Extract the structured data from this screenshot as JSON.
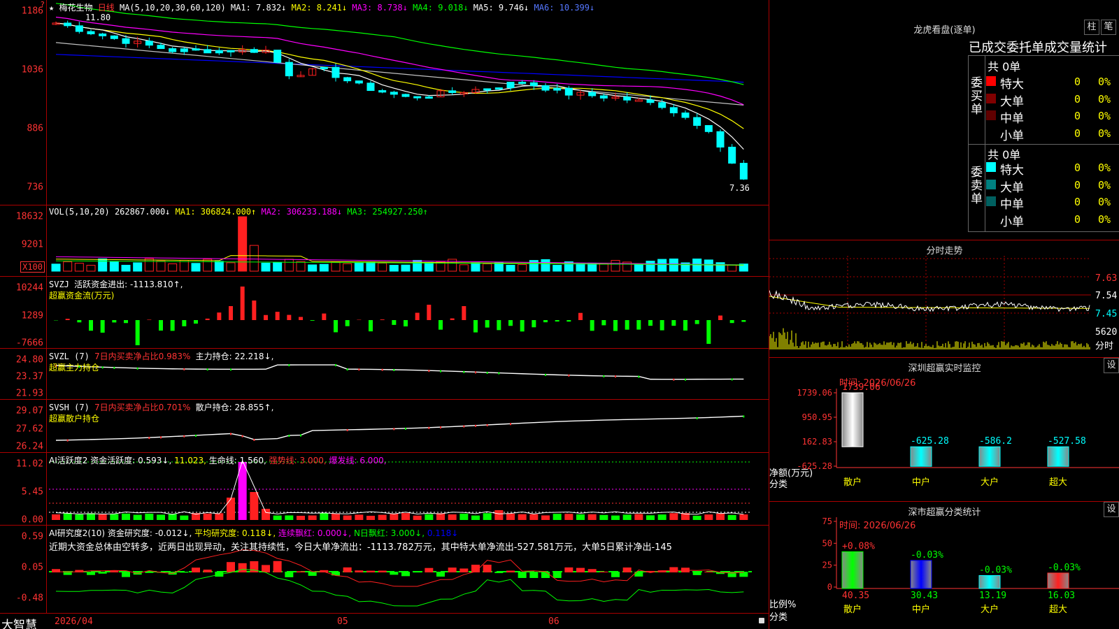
{
  "stock": {
    "name": "梅花生物",
    "period": "日线",
    "star": "★",
    "mark": "?"
  },
  "colors": {
    "up": "#ff2020",
    "down": "#00ffff",
    "ma1": "#ffffff",
    "ma2": "#ffff00",
    "ma3": "#ff00ff",
    "ma4": "#00ff00",
    "ma5": "#c0c0c0",
    "ma6": "#0000ff"
  },
  "price_panel": {
    "header": {
      "label": "MA(5,10,20,30,60,120)",
      "ma1": "MA1: 7.832↓",
      "ma2": "MA2: 8.241↓",
      "ma3": "MA3: 8.738↓",
      "ma4": "MA4: 9.018↓",
      "ma5": "MA5: 9.746↓",
      "ma6": "MA6: 10.399↓"
    },
    "ticks": [
      "1186",
      "1036",
      "886",
      "736"
    ],
    "high_label": "11.80",
    "low_label": "7.36"
  },
  "vol_panel": {
    "header": {
      "label": "VOL(5,10,20)",
      "v": "262867.000↓",
      "ma1": "MA1: 306824.000↑",
      "ma2": "MA2: 306233.188↓",
      "ma3": "MA3: 254927.250↑"
    },
    "ticks": [
      "18632",
      "9201"
    ],
    "unit": "X100"
  },
  "svzj_panel": {
    "header": {
      "label": "SVZJ",
      "text": "活跃资金进出: -1113.810↑,"
    },
    "subtitle": "超赢资金流(万元)",
    "ticks": [
      "10244",
      "1289",
      "-7666"
    ]
  },
  "svzl_panel": {
    "header": {
      "label": "SVZL (7)",
      "text1": "7日内买卖净占比0.983%",
      "text2": "主力持仓: 22.218↓,"
    },
    "subtitle": "超赢主力持仓",
    "ticks": [
      "24.80",
      "23.37",
      "21.93"
    ]
  },
  "svsh_panel": {
    "header": {
      "label": "SVSH (7)",
      "text1": "7日内买卖净占比0.701%",
      "text2": "散户持仓: 28.855↑,"
    },
    "subtitle": "超赢散户持仓",
    "ticks": [
      "29.07",
      "27.62",
      "26.24"
    ]
  },
  "ai_panel": {
    "header": {
      "label": "AI活跃度2",
      "t1": "资金活跃度: 0.593↓,",
      "t2": "11.023,",
      "t3": "生命线: 1.560,",
      "t4": "强势线: 3.000,",
      "t5": "爆发线: 6.000,"
    },
    "ticks": [
      "11.02",
      "5.45",
      "0.00"
    ]
  },
  "research_panel": {
    "header": {
      "label": "AI研究度2(10)",
      "t1": "资金研究度: -0.012↓,",
      "t2": "平均研究度: 0.118↓,",
      "t3": "连续飘红: 0.000↓,",
      "t4": "N日飘红: 3.000↓,",
      "t5": "0.118↓"
    },
    "comment": "近期大资金总体由空转多，近两日出现异动，关注其持续性，今日大单净流出：-1113.782万元，其中特大单净流出-527.581万元，大单5日累计净出-145",
    "ticks": [
      "0.59",
      "0.05",
      "-0.48"
    ]
  },
  "bottom_axis": {
    "brand": "大智慧",
    "date": "2026/04",
    "m1": "05",
    "m2": "06"
  },
  "dragon": {
    "title": "龙虎看盘(逐单)",
    "btn1": "柱",
    "btn2": "笔",
    "subtitle": "已成交委托单成交量统计",
    "buy": {
      "side": "委买单",
      "total": "共 0单",
      "rows": [
        {
          "name": "特大",
          "qty": "0",
          "pct": "0%",
          "color": "#ff0000"
        },
        {
          "name": "大单",
          "qty": "0",
          "pct": "0%",
          "color": "#800000"
        },
        {
          "name": "中单",
          "qty": "0",
          "pct": "0%",
          "color": "#600000"
        },
        {
          "name": "小单",
          "qty": "0",
          "pct": "0%",
          "color": "#000000"
        }
      ]
    },
    "sell": {
      "side": "委卖单",
      "total": "共 0单",
      "rows": [
        {
          "name": "特大",
          "qty": "0",
          "pct": "0%",
          "color": "#00ffff"
        },
        {
          "name": "大单",
          "qty": "0",
          "pct": "0%",
          "color": "#008080"
        },
        {
          "name": "中单",
          "qty": "0",
          "pct": "0%",
          "color": "#006060"
        },
        {
          "name": "小单",
          "qty": "0",
          "pct": "0%",
          "color": "#000000"
        }
      ]
    }
  },
  "intraday": {
    "title": "分时走势",
    "ticks": [
      "7.63",
      "7.54",
      "7.45",
      "5620"
    ],
    "unit": "分时"
  },
  "sz_monitor": {
    "title": "深圳超赢实时监控",
    "btn": "设",
    "time": "时间: 2026/06/26",
    "ticks": [
      "1739.06",
      "950.95",
      "162.83",
      "-625.28"
    ],
    "ylabel": "净额(万元)",
    "xlabel": "分类",
    "top_label": "1739.06"
  },
  "sz_class": {
    "title": "深市超赢分类统计",
    "btn": "设",
    "time": "时间: 2026/06/26",
    "ticks": [
      "75",
      "50",
      "25",
      "0"
    ],
    "ylabel": "比例%",
    "xlabel": "分类"
  },
  "chart_data": [
    {
      "type": "bar",
      "title": "深圳超赢实时监控",
      "categories": [
        "散户",
        "中户",
        "大户",
        "超大"
      ],
      "values": [
        1739.06,
        -625.28,
        -586.2,
        -527.58
      ],
      "labels": [
        "1739.06",
        "-625.28",
        "-586.2",
        "-527.58"
      ],
      "ylabel": "净额(万元)",
      "xlabel": "分类",
      "ylim": [
        -625.28,
        1739.06
      ]
    },
    {
      "type": "bar",
      "title": "深市超赢分类统计",
      "categories": [
        "散户",
        "中户",
        "大户",
        "超大"
      ],
      "values": [
        40.35,
        30.43,
        13.19,
        16.03
      ],
      "changes": [
        "+0.08%",
        "-0.03%",
        "-0.03%",
        "-0.03%"
      ],
      "labels": [
        "40.35",
        "30.43",
        "13.19",
        "16.03"
      ],
      "ylabel": "比例%",
      "xlabel": "分类",
      "ylim": [
        0,
        75
      ]
    }
  ]
}
